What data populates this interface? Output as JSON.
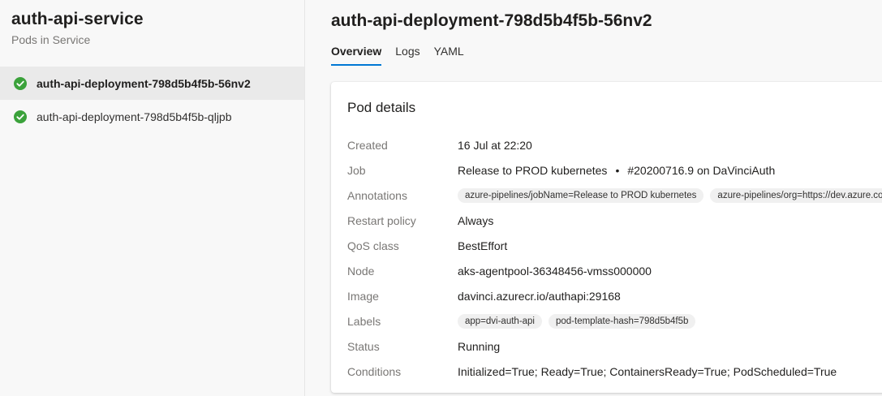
{
  "sidebar": {
    "title": "auth-api-service",
    "subtitle": "Pods in Service",
    "items": [
      {
        "label": "auth-api-deployment-798d5b4f5b-56nv2",
        "status_icon": "check-circle-icon",
        "status_color": "#3ba23b",
        "selected": true
      },
      {
        "label": "auth-api-deployment-798d5b4f5b-qljpb",
        "status_icon": "check-circle-icon",
        "status_color": "#3ba23b",
        "selected": false
      }
    ]
  },
  "main": {
    "title": "auth-api-deployment-798d5b4f5b-56nv2",
    "tabs": [
      {
        "label": "Overview",
        "active": true
      },
      {
        "label": "Logs",
        "active": false
      },
      {
        "label": "YAML",
        "active": false
      }
    ],
    "accent_color": "#0078d4"
  },
  "pod_details": {
    "title": "Pod details",
    "created": {
      "label": "Created",
      "value": "16 Jul at 22:20"
    },
    "job": {
      "label": "Job",
      "value_release": "Release to PROD kubernetes",
      "bullet": "•",
      "value_build": "#20200716.9 on DaVinciAuth"
    },
    "annotations": {
      "label": "Annotations",
      "chips": [
        "azure-pipelines/jobName=Release to PROD kubernetes",
        "azure-pipelines/org=https://dev.azure.com/d"
      ]
    },
    "restart_policy": {
      "label": "Restart policy",
      "value": "Always"
    },
    "qos_class": {
      "label": "QoS class",
      "value": "BestEffort"
    },
    "node": {
      "label": "Node",
      "value": "aks-agentpool-36348456-vmss000000"
    },
    "image": {
      "label": "Image",
      "value": "davinci.azurecr.io/authapi:29168"
    },
    "labels": {
      "label": "Labels",
      "chips": [
        "app=dvi-auth-api",
        "pod-template-hash=798d5b4f5b"
      ]
    },
    "status": {
      "label": "Status",
      "value": "Running"
    },
    "conditions": {
      "label": "Conditions",
      "value": "Initialized=True; Ready=True; ContainersReady=True; PodScheduled=True"
    }
  }
}
